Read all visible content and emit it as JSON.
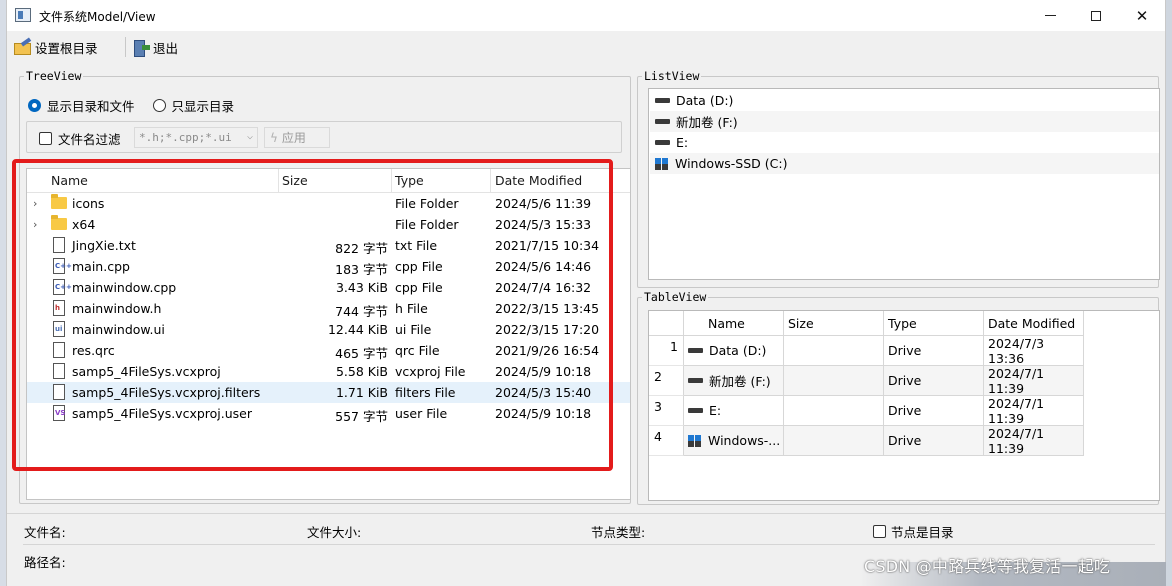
{
  "window": {
    "title": "文件系统Model/View",
    "min_glyph": "—",
    "max_glyph": "☐",
    "close_glyph": "✕"
  },
  "toolbar": {
    "set_root_label": "设置根目录",
    "exit_label": "退出"
  },
  "tree_group": {
    "title": "TreeView",
    "radio_dirs_and_files": "显示目录和文件",
    "radio_dirs_only": "只显示目录",
    "filter_label": "文件名过滤",
    "filter_value": "*.h;*.cpp;*.ui",
    "apply_label": "应用",
    "columns": [
      "Name",
      "Size",
      "Type",
      "Date Modified"
    ],
    "rows": [
      {
        "name": "icons",
        "size": "",
        "type": "File Folder",
        "date": "2024/5/6 11:39",
        "icon": "folder-icon"
      },
      {
        "name": "x64",
        "size": "",
        "type": "File Folder",
        "date": "2024/5/3 15:33",
        "icon": "folder-icon"
      },
      {
        "name": "JingXie.txt",
        "size": "822 字节",
        "type": "txt File",
        "date": "2021/7/15 10:34",
        "icon": "text-file-icon"
      },
      {
        "name": "main.cpp",
        "size": "183 字节",
        "type": "cpp File",
        "date": "2024/5/6 14:46",
        "icon": "cpp-file-icon"
      },
      {
        "name": "mainwindow.cpp",
        "size": "3.43 KiB",
        "type": "cpp File",
        "date": "2024/7/4 16:32",
        "icon": "cpp-file-icon"
      },
      {
        "name": "mainwindow.h",
        "size": "744 字节",
        "type": "h File",
        "date": "2022/3/15 13:45",
        "icon": "header-file-icon"
      },
      {
        "name": "mainwindow.ui",
        "size": "12.44 KiB",
        "type": "ui File",
        "date": "2022/3/15 17:20",
        "icon": "ui-file-icon"
      },
      {
        "name": "res.qrc",
        "size": "465 字节",
        "type": "qrc File",
        "date": "2021/9/26 16:54",
        "icon": "file-icon"
      },
      {
        "name": "samp5_4FileSys.vcxproj",
        "size": "5.58 KiB",
        "type": "vcxproj File",
        "date": "2024/5/9 10:18",
        "icon": "file-icon"
      },
      {
        "name": "samp5_4FileSys.vcxproj.filters",
        "size": "1.71 KiB",
        "type": "filters File",
        "date": "2024/5/3 15:40",
        "icon": "file-icon"
      },
      {
        "name": "samp5_4FileSys.vcxproj.user",
        "size": "557 字节",
        "type": "user File",
        "date": "2024/5/9 10:18",
        "icon": "vs-file-icon"
      }
    ]
  },
  "list_group": {
    "title": "ListView",
    "items": [
      {
        "label": "Data (D:)",
        "icon": "drive-icon"
      },
      {
        "label": "新加卷 (F:)",
        "icon": "drive-icon"
      },
      {
        "label": "E:",
        "icon": "drive-icon"
      },
      {
        "label": "Windows-SSD (C:)",
        "icon": "windows-drive-icon"
      }
    ]
  },
  "table_group": {
    "title": "TableView",
    "columns": [
      "Name",
      "Size",
      "Type",
      "Date Modified"
    ],
    "rows": [
      {
        "num": "1",
        "name": "Data (D:)",
        "size": "",
        "type": "Drive",
        "date": "2024/7/3 13:36"
      },
      {
        "num": "2",
        "name": "新加卷 (F:)",
        "size": "",
        "type": "Drive",
        "date": "2024/7/1 11:39"
      },
      {
        "num": "3",
        "name": "E:",
        "size": "",
        "type": "Drive",
        "date": "2024/7/1 11:39"
      },
      {
        "num": "4",
        "name": "Windows-...",
        "size": "",
        "type": "Drive",
        "date": "2024/7/1 11:39"
      }
    ]
  },
  "status": {
    "filename_label": "文件名:",
    "filesize_label": "文件大小:",
    "nodetype_label": "节点类型:",
    "isdir_label": "节点是目录",
    "path_label": "路径名:"
  },
  "watermark": "CSDN @中路兵线等我复活一起吃",
  "colors": {
    "annotation_red": "#e31b1b",
    "selected_row": "#e5f1fb",
    "radio_accent": "#0067c0"
  }
}
